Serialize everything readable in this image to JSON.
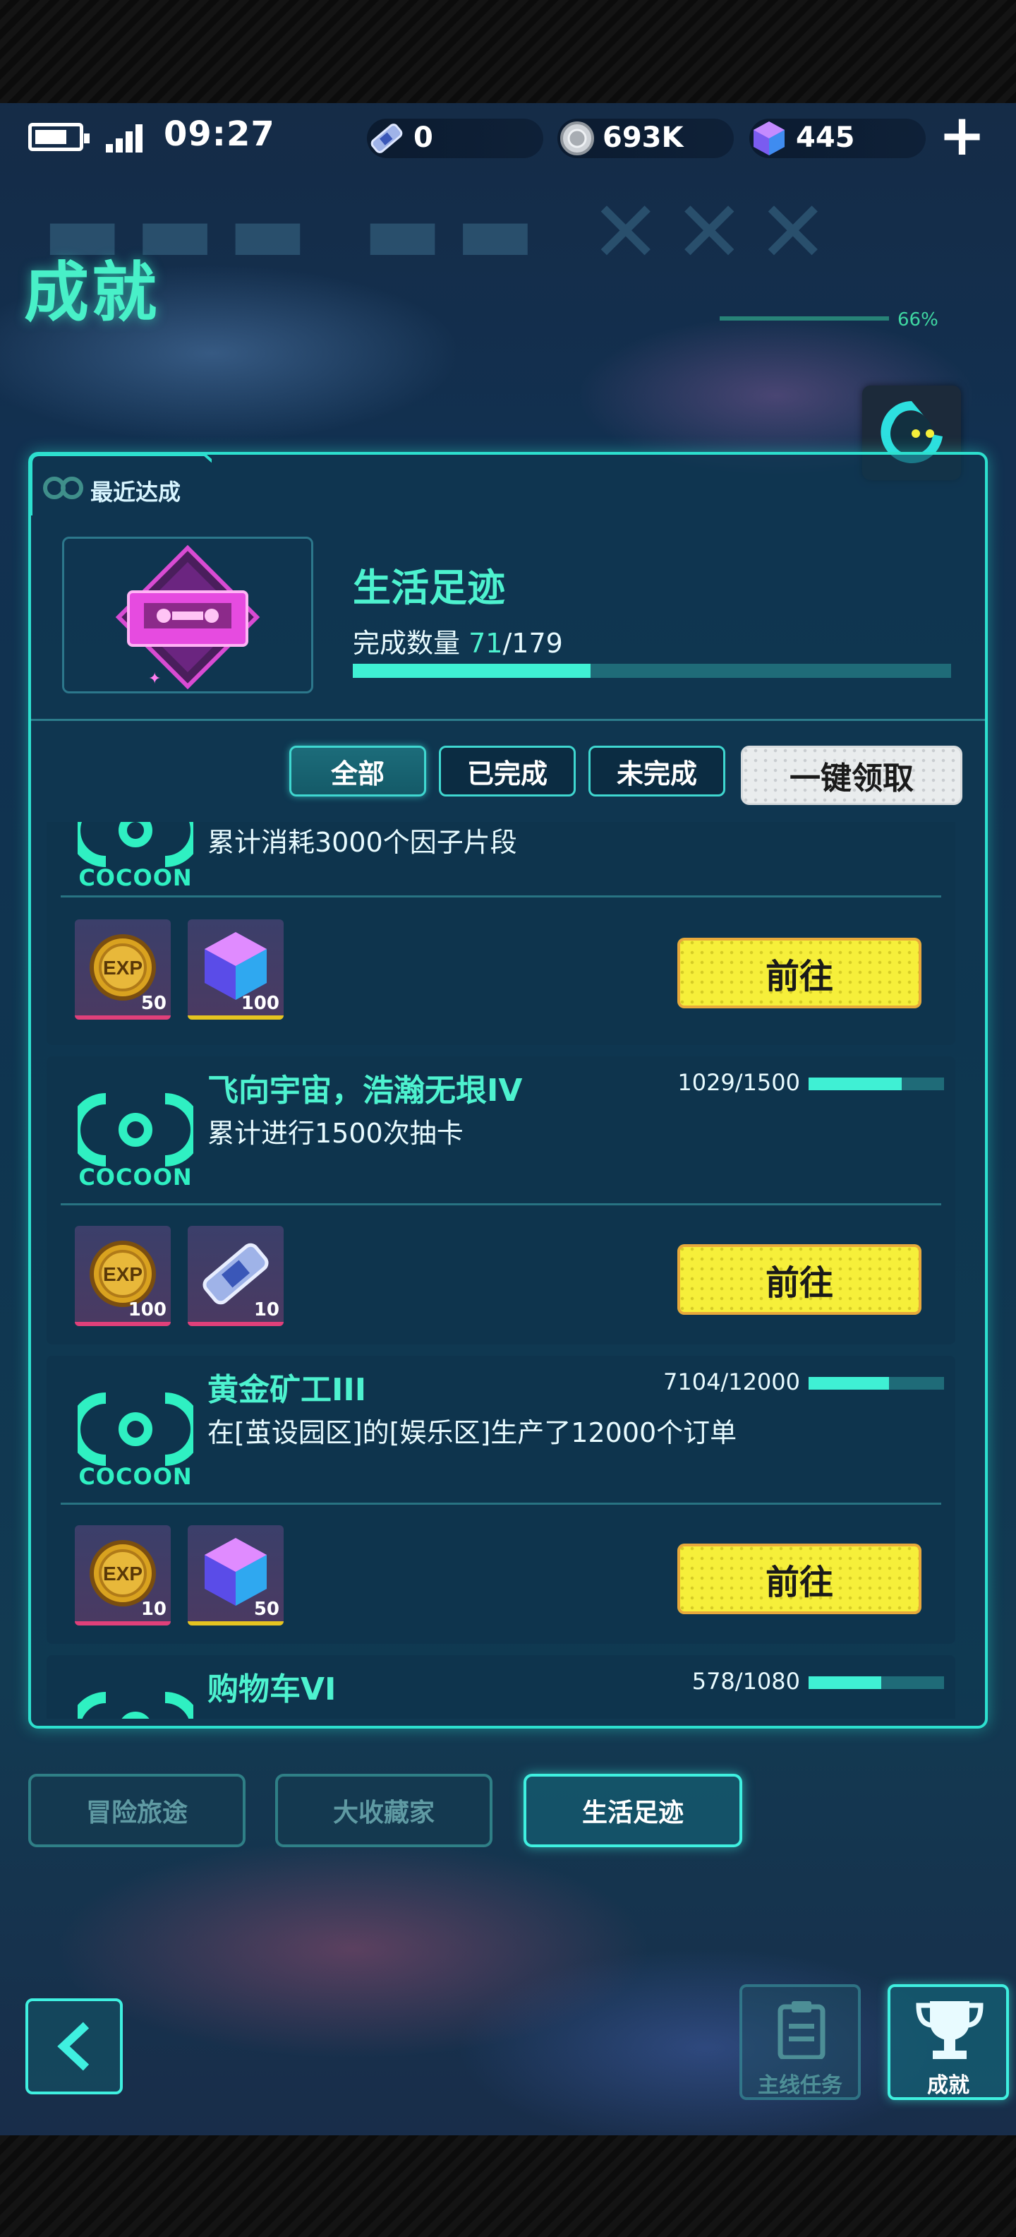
{
  "status_bar": {
    "time": "09:27",
    "resources": [
      {
        "icon": "ticket-icon",
        "value": "0"
      },
      {
        "icon": "coin-icon",
        "value": "693K"
      },
      {
        "icon": "gem-icon",
        "value": "445"
      }
    ],
    "add_label": "+"
  },
  "header": {
    "title": "成就",
    "progress_text": "66%"
  },
  "recent": {
    "label": "最近达成",
    "badge_title": "生活足迹",
    "count_label": "完成数量",
    "count_done": "71",
    "count_total": "/179",
    "progress": 0.397
  },
  "filters": {
    "all": "全部",
    "done": "已完成",
    "undone": "未完成",
    "claim_all": "一键领取"
  },
  "cocoon_text": "COCOON",
  "achievements": [
    {
      "title": "",
      "desc": "累计消耗3000个因子片段",
      "progress_text": "",
      "progress": 0,
      "rewards": [
        {
          "icon": "exp-coin-icon",
          "qty": "50"
        },
        {
          "icon": "gem-icon",
          "qty": "100"
        }
      ],
      "go_label": "前往"
    },
    {
      "title": "飞向宇宙，浩瀚无垠IV",
      "desc": "累计进行1500次抽卡",
      "progress_text": "1029/1500",
      "progress": 0.686,
      "rewards": [
        {
          "icon": "exp-coin-icon",
          "qty": "100"
        },
        {
          "icon": "ticket-icon",
          "qty": "10"
        }
      ],
      "go_label": "前往"
    },
    {
      "title": "黄金矿工III",
      "desc": "在[茧设园区]的[娱乐区]生产了12000个订单",
      "progress_text": "7104/12000",
      "progress": 0.592,
      "rewards": [
        {
          "icon": "exp-coin-icon",
          "qty": "10"
        },
        {
          "icon": "gem-icon",
          "qty": "50"
        }
      ],
      "go_label": "前往"
    },
    {
      "title": "购物车VI",
      "desc": "",
      "progress_text": "578/1080",
      "progress": 0.535,
      "rewards": [],
      "go_label": ""
    }
  ],
  "categories": {
    "adventure": "冒险旅途",
    "collector": "大收藏家",
    "life": "生活足迹"
  },
  "nav": {
    "main_quest": "主线任务",
    "achievement": "成就"
  },
  "colors": {
    "accent": "#3ff0d4",
    "button_yellow": "#f6ef3a",
    "panel_border": "#2de0cf"
  }
}
